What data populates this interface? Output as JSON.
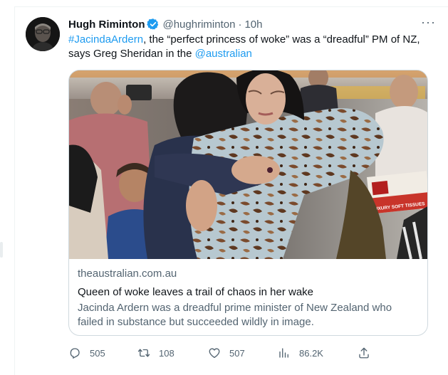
{
  "tweet": {
    "author_name": "Hugh Riminton",
    "verified_icon": "verified-badge-icon",
    "handle": "@hughriminton",
    "separator": "·",
    "timestamp": "10h",
    "more_icon": "more-horizontal-icon",
    "more_label": "···",
    "text": {
      "hashtag": "#JacindaArdern",
      "part1": ", the “perfect princess of woke” was a “dreadful” PM of NZ, says Greg Sheridan in  the ",
      "mention": "@australian"
    },
    "card": {
      "domain": "theaustralian.com.au",
      "title": "Queen of woke leaves a trail of chaos in her wake",
      "description": "Jacinda Ardern was a dreadful prime minister of New Zealand who failed in substance but succeeded wildly in image.",
      "image_box_text": "LUXURY SOFT TISSUES"
    },
    "actions": {
      "reply": {
        "icon": "reply-icon",
        "count": "505"
      },
      "retweet": {
        "icon": "retweet-icon",
        "count": "108"
      },
      "like": {
        "icon": "heart-icon",
        "count": "507"
      },
      "views": {
        "icon": "views-icon",
        "count": "86.2K"
      },
      "share": {
        "icon": "share-icon"
      }
    },
    "colors": {
      "link": "#1d9bf0",
      "secondary_text": "#536471",
      "primary_text": "#0f1419",
      "border": "#cfd9de"
    }
  }
}
